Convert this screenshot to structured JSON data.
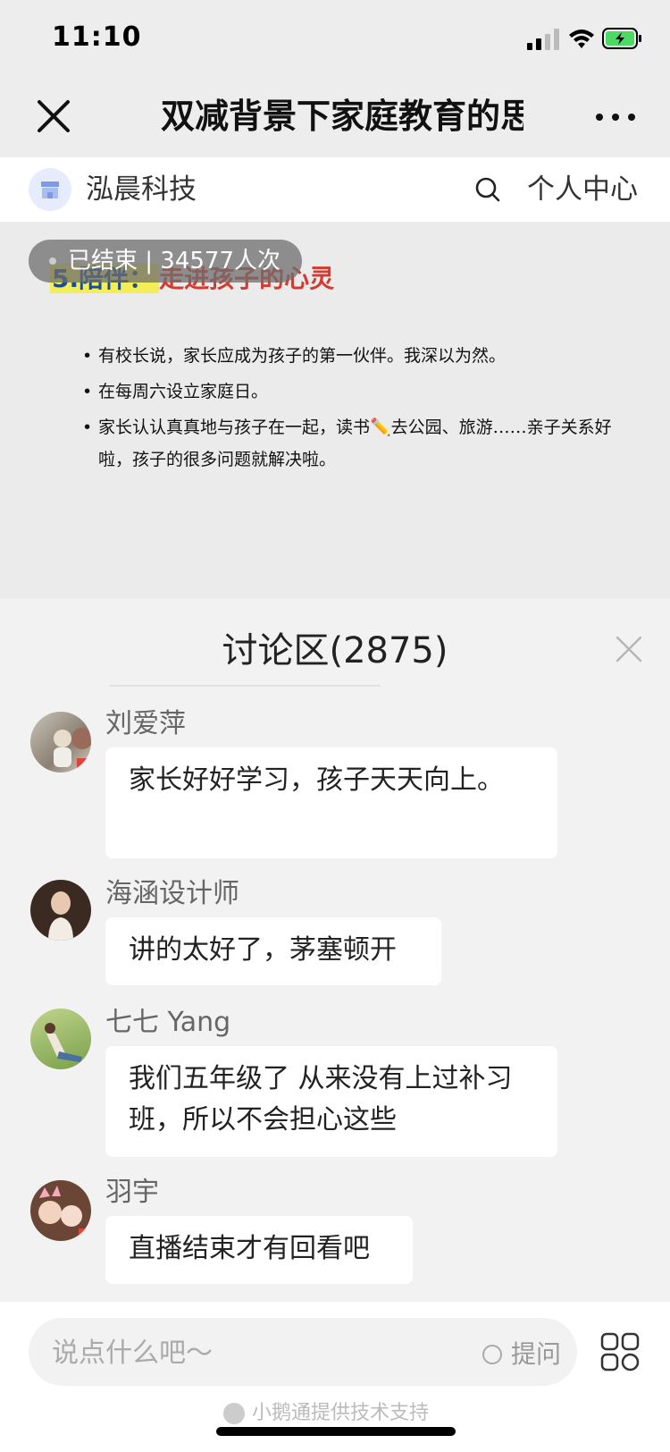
{
  "status": {
    "time": "11:10"
  },
  "nav": {
    "title": "双减背景下家庭教育的思"
  },
  "shop": {
    "name": "泓晨科技",
    "personal_center": "个人中心"
  },
  "slide": {
    "heading_num": "5.陪伴：",
    "heading_text": "走进孩子的心灵",
    "badge": "已结束 | 34577人次",
    "bullets": [
      "有校长说，家长应成为孩子的第一伙伴。我深以为然。",
      "在每周六设立家庭日。",
      "家长认认真真地与孩子在一起，读书✏️去公园、旅游……亲子关系好啦，孩子的很多问题就解决啦。"
    ]
  },
  "discussion": {
    "title": "讨论区(2875)",
    "comments": [
      {
        "user": "刘爱萍",
        "text": "家长好好学习，孩子天天向上。"
      },
      {
        "user": "海涵设计师",
        "text": "讲的太好了，茅塞顿开"
      },
      {
        "user": "七七 Yang",
        "text": "我们五年级了 从来没有上过补习班，所以不会担心这些"
      },
      {
        "user": "羽宇",
        "text": "直播结束才有回看吧"
      }
    ]
  },
  "input": {
    "placeholder": "说点什么吧～",
    "ask_label": "提问"
  },
  "footer": {
    "powered_by": "小鹅通提供技术支持"
  },
  "colors": {
    "highlight_red": "#d5392f",
    "highlight_yellow": "#f3ee57"
  }
}
